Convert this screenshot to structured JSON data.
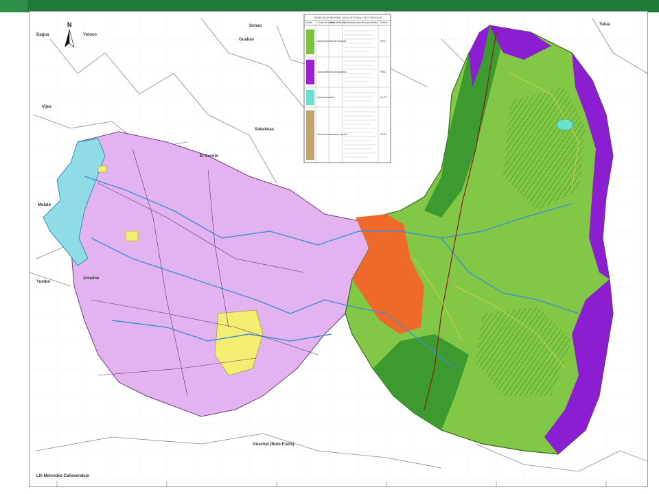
{
  "header": {
    "bar_color": "#1f7a38"
  },
  "map": {
    "north_label": "N",
    "places": {
      "dagua": "Dagua",
      "yotoco": "Yotoco",
      "guabas": "Guabas",
      "sonso": "Sonso",
      "tulua": "Tulua",
      "vijes": "Vijes",
      "sabaletas": "Sabaletas",
      "el_cerrito": "El Cerrito",
      "mulalo": "Mulalo",
      "yumbo": "Yumbo",
      "amaime": "Amaime",
      "guachal": "Guachal (Bolo-Fraile)",
      "lili": "Lili-Melendez-Cañaveralejo"
    },
    "legend": {
      "title": "ZONIFICACION REGIONAL ZONAL SECTORIAL / SECTORIZACION",
      "headers": [
        "Unidad",
        "Zonas de Manejo",
        "Área destinada",
        "Actividades específicas permitidas",
        "Función"
      ],
      "zones": [
        {
          "name": "Zona protectora de bosques",
          "color": "#7fc241",
          "func": "P.B.E"
        },
        {
          "name": "Zona protectora de páramos",
          "color": "#9c1fd6",
          "func": "P.M.E"
        },
        {
          "name": "Zona humedales",
          "color": "#66e0cf",
          "func": "H.U.Z"
        },
        {
          "name": "Zona de restauración natural",
          "color": "#c4a36e",
          "func": "R.N.R"
        }
      ]
    },
    "colors": {
      "valley": "#e3b3f0",
      "wetland": "#8fdce6",
      "forest": "#82c846",
      "dark_forest": "#3d9a2e",
      "paramo": "#8a1ed0",
      "erosion": "#ef6a2a",
      "urban": "#f3ee72",
      "river": "#3a8fd6"
    }
  }
}
